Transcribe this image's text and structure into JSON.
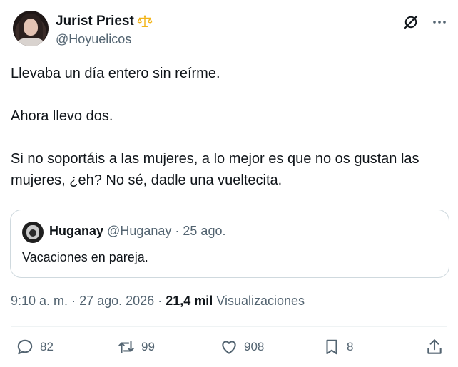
{
  "author": {
    "display_name": "Jurist Priest",
    "handle": "@Hoyuelicos",
    "badge_icon": "scales-icon",
    "badge_color": "#f4b400"
  },
  "header_actions": {
    "grok_icon": "grok-icon",
    "more_icon": "more-icon"
  },
  "tweet": {
    "lines": [
      "Llevaba un día entero sin reírme.",
      "Ahora llevo dos.",
      "Si no soportáis a las mujeres, a lo mejor es que no os gustan las mujeres, ¿eh? No sé, dadle una vueltecita."
    ]
  },
  "quote": {
    "display_name": "Huganay",
    "handle": "@Huganay",
    "separator": "·",
    "date": "25 ago.",
    "text": "Vacaciones en pareja."
  },
  "meta": {
    "time": "9:10 a. m.",
    "separator": "·",
    "date": "27 ago. 2026",
    "views_count": "21,4 mil",
    "views_label": "Visualizaciones"
  },
  "actions": {
    "replies": "82",
    "reposts": "99",
    "likes": "908",
    "bookmarks": "8",
    "accent_color": "#536471"
  }
}
